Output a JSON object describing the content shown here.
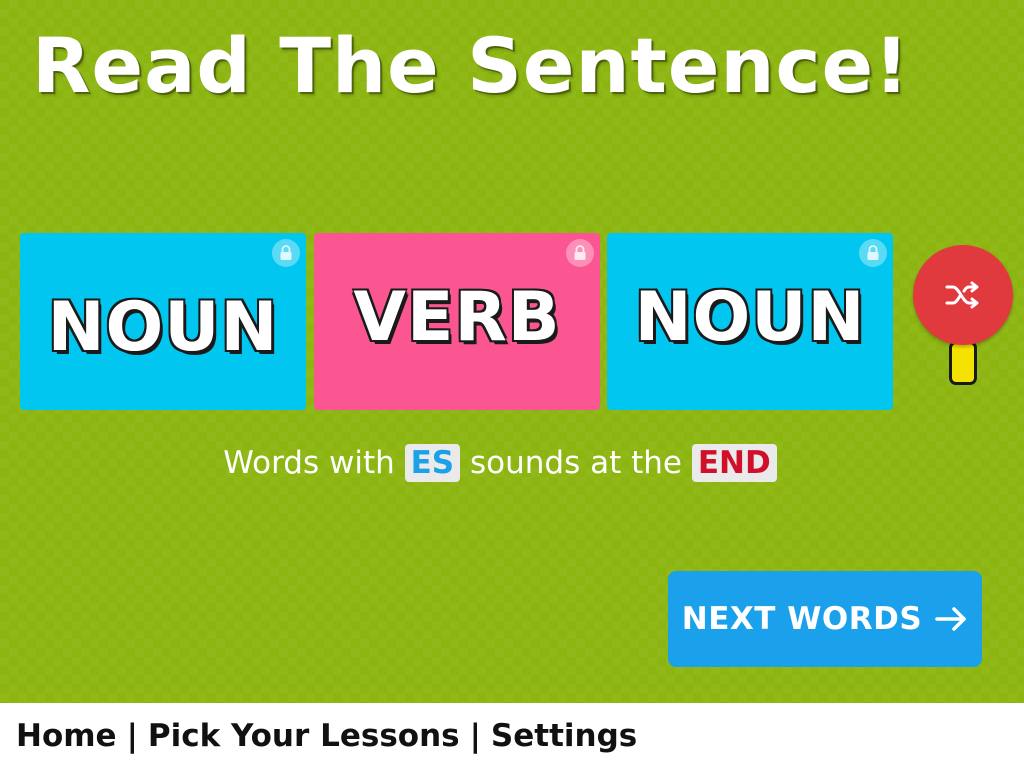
{
  "page": {
    "title": "Read The Sentence!"
  },
  "cards": [
    {
      "word": "NOUN",
      "color": "#00c6f0",
      "lock_icon": "lock-icon"
    },
    {
      "word": "VERB",
      "color": "#fb5592",
      "lock_icon": "lock-icon"
    },
    {
      "word": "NOUN",
      "color": "#00c6f0",
      "lock_icon": "lock-icon"
    }
  ],
  "shuffle": {
    "icon": "shuffle-icon",
    "color": "#e03a3e"
  },
  "lesson": {
    "prefix": "Words with",
    "sound": "ES",
    "middle": "sounds at the",
    "position": "END",
    "sound_color": "#1ba1e8",
    "position_color": "#d0102a"
  },
  "next_button": {
    "label": "NEXT WORDS",
    "icon": "arrow-right-icon",
    "color": "#1ba1ec"
  },
  "footer": {
    "home": "Home",
    "separator": "|",
    "pick_lessons": "Pick Your Lessons",
    "settings": "Settings"
  },
  "colors": {
    "background": "#8cb511"
  }
}
